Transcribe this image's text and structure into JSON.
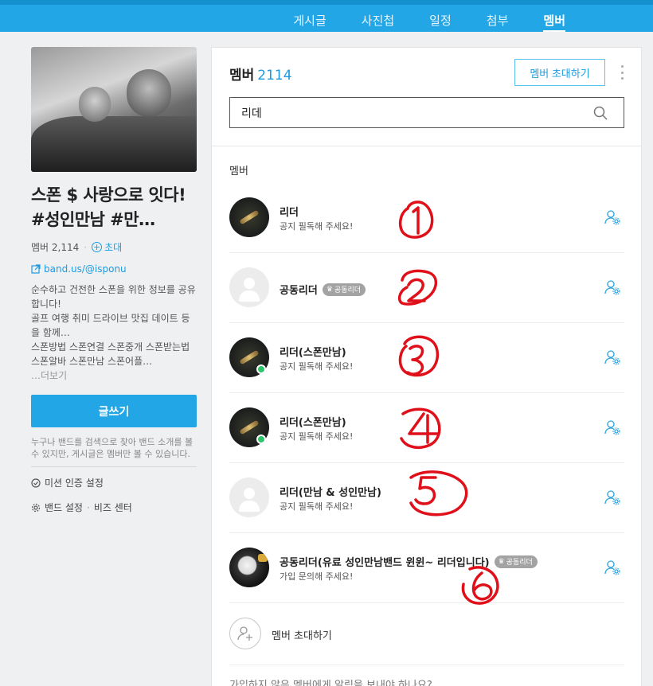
{
  "top_nav": {
    "tabs": [
      {
        "label": "게시글"
      },
      {
        "label": "사진첩"
      },
      {
        "label": "일정"
      },
      {
        "label": "첨부"
      },
      {
        "label": "멤버"
      }
    ],
    "active_tab": "멤버"
  },
  "sidebar": {
    "band_name": "스폰 $ 사랑으로 잇다! #성인만남 #만…",
    "member_count_label": "멤버 2,114",
    "invite_label": "초대",
    "url": "band.us/@isponu",
    "description": "순수하고 건전한 스폰을 위한 정보를 공유합니다!\n골프 여행 취미 드라이브 맛집 데이트 등을 함께…\n스폰방법 스폰연결 스폰중개 스폰받는법 스폰알바 스폰만남 스폰어플…",
    "more_label": "…더보기",
    "write_button": "글쓰기",
    "note": "누구나 밴드를 검색으로 찾아 밴드 소개를 볼 수 있지만, 게시글은 멤버만 볼 수 있습니다.",
    "mission_label": "미션 인증 설정",
    "settings_label": "밴드 설정",
    "biz_label": "비즈 센터"
  },
  "main": {
    "title": "멤버",
    "count": "2114",
    "invite_button": "멤버 초대하기",
    "search_value": "리데",
    "section_label": "멤버",
    "members": [
      {
        "name": "리더",
        "status": "공지 필독해 주세요!",
        "badge": "",
        "avatar": "dark",
        "online": false
      },
      {
        "name": "공동리더",
        "status": "",
        "badge": "공동리더",
        "avatar": "empty",
        "online": false
      },
      {
        "name": "리더(스폰만남)",
        "status": "공지 필독해 주세요!",
        "badge": "",
        "avatar": "dark",
        "online": true
      },
      {
        "name": "리더(스폰만남)",
        "status": "공지 필독해 주세요!",
        "badge": "",
        "avatar": "dark",
        "online": true
      },
      {
        "name": "리더(만남 & 성인만남)",
        "status": "공지 필독해 주세요!",
        "badge": "",
        "avatar": "empty",
        "online": false
      },
      {
        "name": "공동리더(유료 성인만남밴드 윈윈~ 리더입니다)",
        "status": "가입 문의해 주세요!",
        "badge": "공동리더",
        "avatar": "clock",
        "online": false
      }
    ],
    "invite_row_label": "멤버 초대하기",
    "bottom_text": "가입하지 않은 멤버에게 알림을 보내야 하나요?"
  },
  "annotations": [
    "1",
    "2",
    "3",
    "4",
    "5",
    "6"
  ],
  "colors": {
    "brand": "#22a6e6",
    "annotation": "#e0101a",
    "badge": "#a3a3a3"
  }
}
